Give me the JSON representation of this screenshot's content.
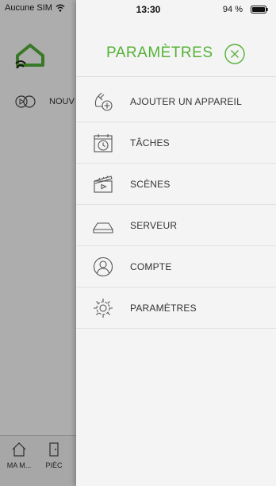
{
  "status_bar": {
    "carrier": "Aucune SIM",
    "time": "13:30",
    "battery": "94 %"
  },
  "background_app": {
    "row_label": "NOUV",
    "tabs": [
      {
        "label": "MA M..."
      },
      {
        "label": "PIÈC"
      }
    ]
  },
  "drawer": {
    "title": "PARAMÈTRES",
    "accent_color": "#55b238",
    "items": [
      {
        "label": "AJOUTER UN APPAREIL",
        "icon": "add-device-icon"
      },
      {
        "label": "TÂCHES",
        "icon": "calendar-clock-icon"
      },
      {
        "label": "SCÈNES",
        "icon": "clapperboard-icon"
      },
      {
        "label": "SERVEUR",
        "icon": "server-icon"
      },
      {
        "label": "COMPTE",
        "icon": "account-icon"
      },
      {
        "label": "PARAMÈTRES",
        "icon": "gear-icon"
      }
    ]
  }
}
